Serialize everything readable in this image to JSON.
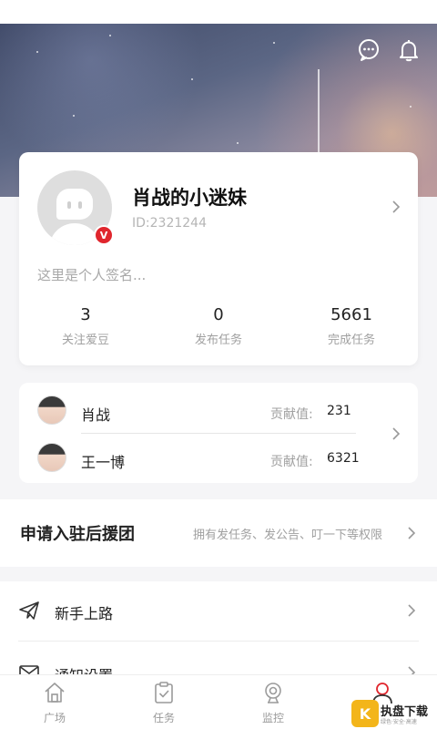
{
  "header": {
    "message_icon": "chat-bubble-icon",
    "bell_icon": "bell-icon"
  },
  "profile": {
    "name": "肖战的小迷妹",
    "id_text": "ID:2321244",
    "badge": "V",
    "signature_placeholder": "这里是个人签名...",
    "stats": [
      {
        "value": "3",
        "label": "关注爱豆"
      },
      {
        "value": "0",
        "label": "发布任务"
      },
      {
        "value": "5661",
        "label": "完成任务"
      }
    ]
  },
  "idols": [
    {
      "name": "肖战",
      "contrib_label": "贡献值:",
      "contrib_value": "231"
    },
    {
      "name": "王一博",
      "contrib_label": "贡献值:",
      "contrib_value": "6321"
    }
  ],
  "apply": {
    "title": "申请入驻后援团",
    "desc": "拥有发任务、发公告、叮一下等权限"
  },
  "menu": [
    {
      "label": "新手上路",
      "icon": "paper-plane-icon"
    },
    {
      "label": "通知设置",
      "icon": "mail-icon"
    }
  ],
  "tabs": [
    {
      "label": "广场",
      "icon": "home-icon",
      "active": false
    },
    {
      "label": "任务",
      "icon": "clipboard-check-icon",
      "active": false
    },
    {
      "label": "监控",
      "icon": "webcam-icon",
      "active": false
    },
    {
      "label": "",
      "icon": "user-icon",
      "active": true
    }
  ],
  "watermark": {
    "logo": "K",
    "title": "执盘下载",
    "subtitle": "绿色·安全·高速"
  },
  "colors": {
    "accent_red": "#e0262d",
    "text_primary": "#222222",
    "text_secondary": "#a0a0a0",
    "background": "#f5f5f7"
  }
}
